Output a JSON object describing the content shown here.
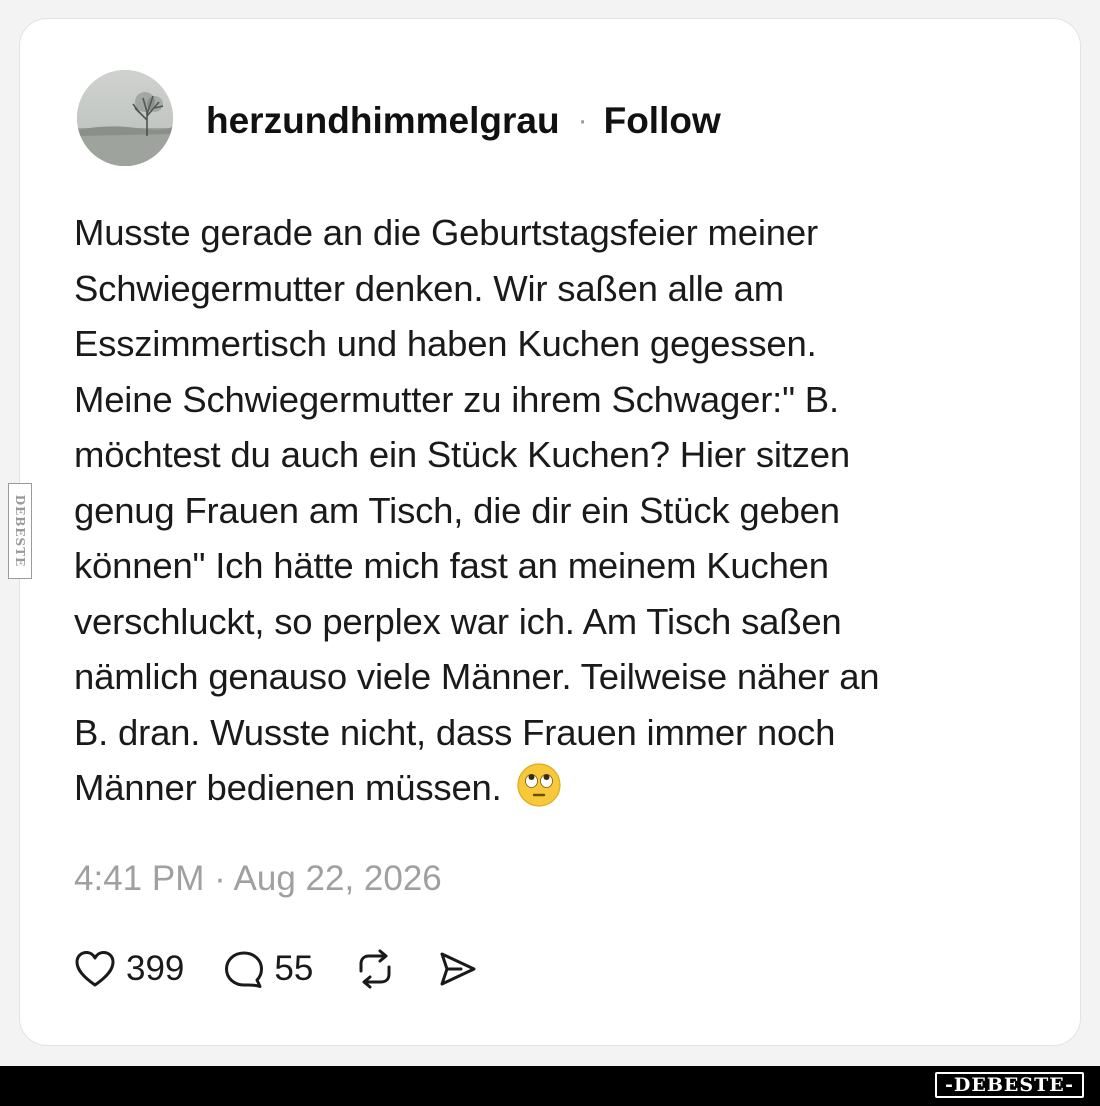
{
  "post": {
    "username": "herzundhimmelgrau",
    "separator": "·",
    "follow_label": "Follow",
    "text": "Musste gerade an die Geburtstagsfeier meiner\nSchwiegermutter denken. Wir saßen alle am\nEsszimmertisch und haben Kuchen gegessen.\nMeine Schwiegermutter zu ihrem Schwager:\" B.\nmöchtest du auch ein Stück Kuchen? Hier sitzen\ngenug Frauen am Tisch, die dir ein Stück geben\nkönnen\" Ich hätte mich fast an meinem Kuchen\nverschluckt, so perplex war ich. Am Tisch saßen\nnämlich genauso viele Männer. Teilweise näher an\nB. dran. Wusste nicht, dass Frauen immer noch\nMänner bedienen müssen.",
    "emoji": "face-with-rolling-eyes",
    "timestamp": "4:41 PM · Aug 22, 2026"
  },
  "actions": {
    "like_icon": "heart-icon",
    "like_count": "399",
    "reply_icon": "comment-bubble-icon",
    "reply_count": "55",
    "repost_icon": "repost-icon",
    "share_icon": "send-icon"
  },
  "watermark": {
    "side_label": "DEBESTE",
    "bottom_label": "-DEBESTE-"
  },
  "colors": {
    "background": "#f3f3f3",
    "card": "#ffffff",
    "text": "#1a1a1a",
    "muted": "#a0a0a0",
    "bar": "#000000"
  }
}
